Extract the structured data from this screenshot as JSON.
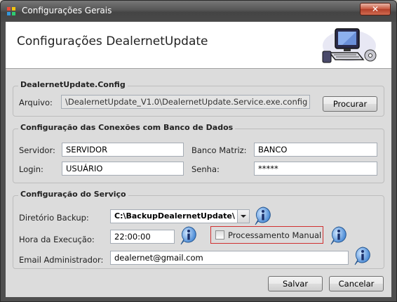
{
  "window": {
    "title": "Configurações Gerais",
    "close_glyph": "✕"
  },
  "header": {
    "title": "Configurações DealernetUpdate"
  },
  "config_group": {
    "title": "DealernetUpdate.Config",
    "file_label": "Arquivo:",
    "file_value": "\\DealernetUpdate_V1.0\\DealernetUpdate.Service.exe.config",
    "browse_label": "Procurar"
  },
  "db_group": {
    "title": "Configuração das Conexões com Banco de Dados",
    "server_label": "Servidor:",
    "server_value": "SERVIDOR",
    "master_db_label": "Banco Matriz:",
    "master_db_value": "BANCO",
    "login_label": "Login:",
    "login_value": "USUÁRIO",
    "password_label": "Senha:",
    "password_value": "*****"
  },
  "service_group": {
    "title": "Configuração do Serviço",
    "backup_dir_label": "Diretório Backup:",
    "backup_dir_value": "C:\\BackupDealernetUpdate\\",
    "exec_time_label": "Hora da Execução:",
    "exec_time_value": "22:00:00",
    "manual_processing_label": "Processamento Manual",
    "manual_processing_checked": false,
    "admin_email_label": "Email Administrador:",
    "admin_email_value": "dealernet@gmail.com"
  },
  "footer": {
    "save_label": "Salvar",
    "cancel_label": "Cancelar"
  }
}
